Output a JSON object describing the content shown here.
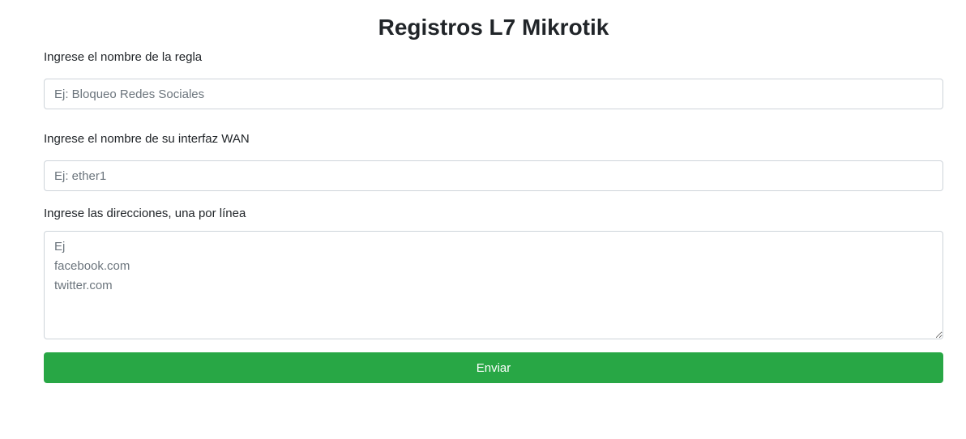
{
  "page": {
    "title": "Registros L7 Mikrotik"
  },
  "form": {
    "rule_name": {
      "label": "Ingrese el nombre de la regla",
      "placeholder": "Ej: Bloqueo Redes Sociales",
      "value": ""
    },
    "wan_interface": {
      "label": "Ingrese el nombre de su interfaz WAN",
      "placeholder": "Ej: ether1",
      "value": ""
    },
    "addresses": {
      "label": "Ingrese las direcciones, una por línea",
      "placeholder": "Ej\nfacebook.com\ntwitter.com",
      "value": ""
    },
    "submit_label": "Enviar"
  },
  "colors": {
    "submit_button": "#28a745",
    "input_border": "#ced4da"
  }
}
